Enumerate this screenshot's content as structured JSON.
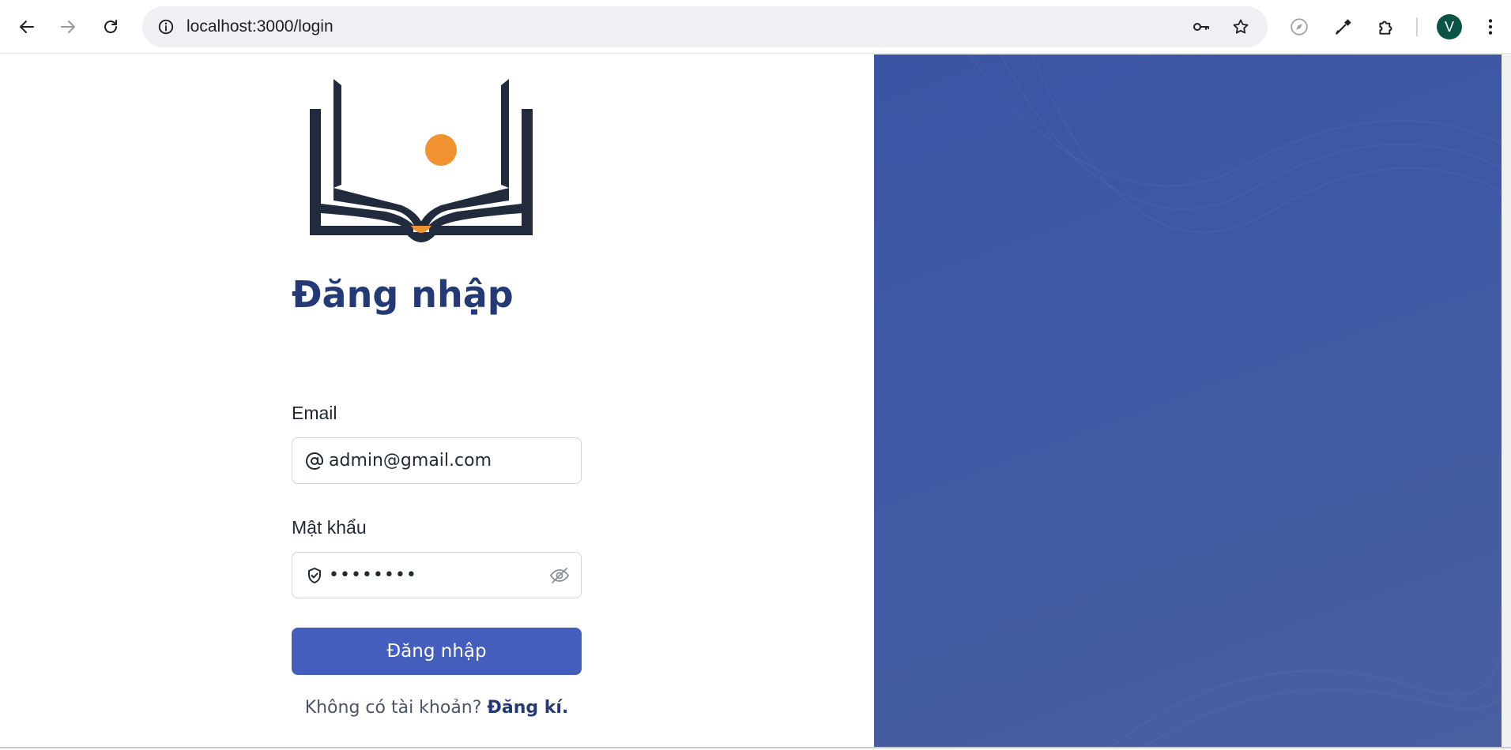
{
  "browser": {
    "url_host": "localhost",
    "url_path": ":3000/login",
    "profile_initial": "V",
    "icons": {
      "back": "arrow-left-icon",
      "forward": "arrow-right-icon",
      "reload": "reload-icon",
      "site_info": "info-icon",
      "password_manager": "key-icon",
      "bookmark": "star-icon",
      "extension_compass": "compass-icon",
      "eyedropper": "eyedropper-icon",
      "extensions": "puzzle-icon",
      "menu": "kebab-menu-icon"
    },
    "colors": {
      "avatar_bg": "#0b5345",
      "address_bar_bg": "#eef0f3"
    }
  },
  "login": {
    "title": "Đăng nhập",
    "email_label": "Email",
    "email_value": "admin@gmail.com",
    "password_label": "Mật khẩu",
    "password_value": "••••••••",
    "submit_label": "Đăng nhập",
    "signup_prompt": "Không có tài khoản? ",
    "signup_link": "Đăng kí.",
    "icons": {
      "logo": "open-book-logo",
      "email_prefix": "at-sign-icon",
      "password_prefix": "shield-check-icon",
      "password_toggle": "eye-off-icon"
    },
    "colors": {
      "title": "#243a76",
      "button": "#435ebc",
      "side_panel": "#3d57a4",
      "logo_dark": "#222a3d",
      "logo_accent": "#f0922f"
    }
  }
}
